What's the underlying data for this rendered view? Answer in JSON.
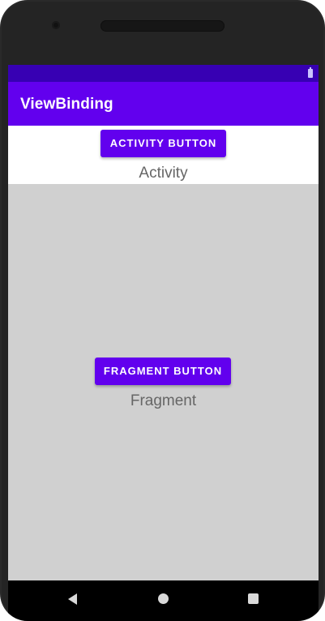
{
  "app": {
    "title": "ViewBinding"
  },
  "activity": {
    "button_label": "ACTIVITY BUTTON",
    "label": "Activity"
  },
  "fragment": {
    "button_label": "FRAGMENT BUTTON",
    "label": "Fragment"
  },
  "colors": {
    "primary": "#6200ee",
    "status_bar": "#3700b3",
    "fragment_background": "#d0d0d0",
    "navigation_bar": "#000000"
  },
  "icons": {
    "battery": "battery-icon",
    "back": "back-icon",
    "home": "home-icon",
    "recents": "recents-icon",
    "cursor": "mouse-pointer-icon"
  }
}
